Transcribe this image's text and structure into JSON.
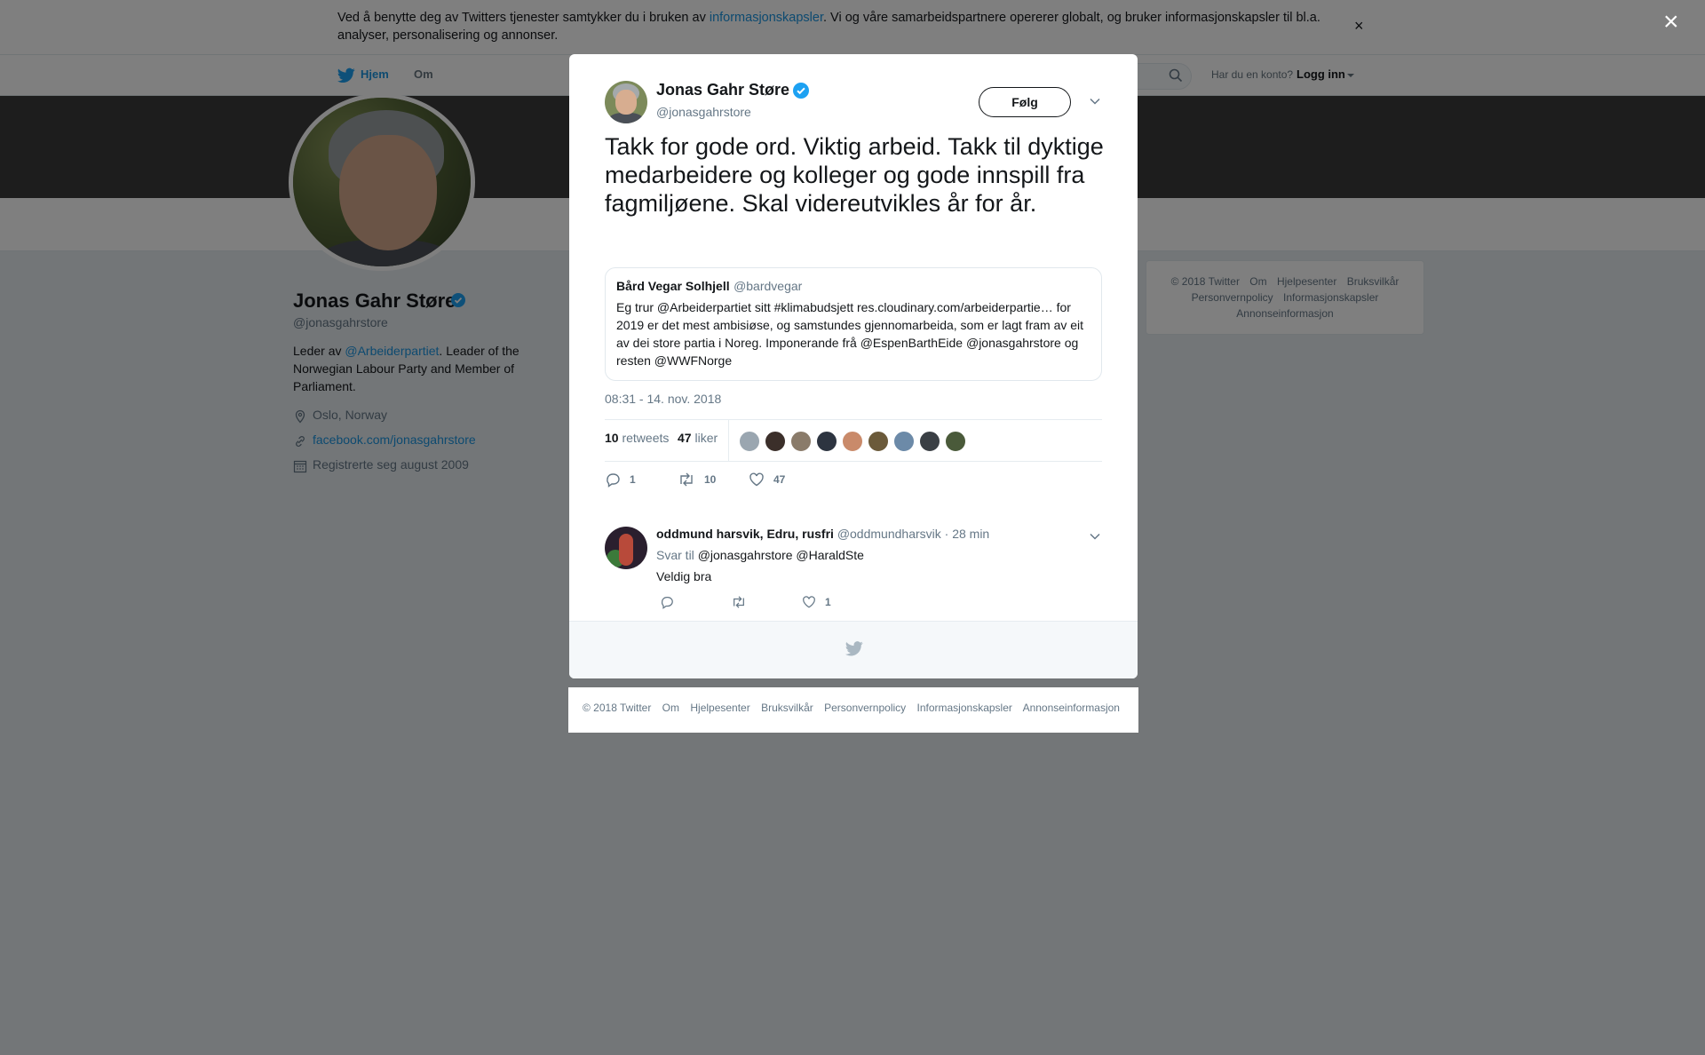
{
  "cookie_banner": {
    "text_before": "Ved å benytte deg av Twitters tjenester samtykker du i bruken av ",
    "link": "informasjonskapsler",
    "text_after": ". Vi og våre samarbeidspartnere opererer globalt, og bruker informasjonskapsler til bl.a. analyser, personalisering og annonser.",
    "close": "×"
  },
  "topnav": {
    "home": "Hjem",
    "about": "Om",
    "account_prompt": "Har du en konto?",
    "login": "Logg inn"
  },
  "profile": {
    "name": "Jonas Gahr Støre",
    "handle": "@jonasgahrstore",
    "bio_prefix": "Leder av ",
    "bio_mention": "@Arbeiderpartiet",
    "bio_suffix": ". Leader of the Norwegian Labour Party and Member of Parliament.",
    "location": "Oslo, Norway",
    "website": "facebook.com/jonasgahrstore",
    "joined": "Registrerte seg august 2009"
  },
  "side_footer": [
    "© 2018 Twitter",
    "Om",
    "Hjelpesenter",
    "Bruksvilkår",
    "Personvernpolicy",
    "Informasjonskapsler",
    "Annonseinformasjon"
  ],
  "overlay_close": "×",
  "tweet": {
    "author_name": "Jonas Gahr Støre",
    "author_handle": "@jonasgahrstore",
    "follow_label": "Følg",
    "text": "Takk for gode ord. Viktig arbeid. Takk til dyktige medarbeidere og kolleger og gode innspill fra fagmiljøene. Skal videreutvikles år for år.",
    "quote": {
      "name": "Bård Vegar Solhjell",
      "handle": "@bardvegar",
      "text": "Eg trur @Arbeiderpartiet sitt #klimabudsjett res.cloudinary.com/arbeiderpartie… for 2019 er det mest ambisiøse, og samstundes gjennomarbeida, som er lagt fram av eit av dei store partia i Noreg. Imponerande frå @EspenBarthEide @jonasgahrstore og resten @WWFNorge"
    },
    "timestamp": "08:31 - 14. nov. 2018",
    "retweets_count": "10",
    "retweets_label": "retweets",
    "likes_count": "47",
    "likes_label": "liker",
    "actions": {
      "replies": "1",
      "retweets": "10",
      "likes": "47"
    }
  },
  "reply": {
    "name": "oddmund harsvik, Edru, rusfri",
    "handle": "@oddmundharsvik",
    "time": "· 28 min",
    "reply_to_label": "Svar til",
    "reply_to_mentions": "@jonasgahrstore @HaraldSte",
    "text": "Veldig bra",
    "actions": {
      "replies": "",
      "retweets": "",
      "likes": "1"
    }
  },
  "modal_footer": [
    "© 2018 Twitter",
    "Om",
    "Hjelpesenter",
    "Bruksvilkår",
    "Personvernpolicy",
    "Informasjonskapsler",
    "Annonseinformasjon"
  ],
  "colors": {
    "accent": "#1b95e0",
    "verified": "#1da1f2",
    "text": "#14171a",
    "muted": "#657786"
  }
}
